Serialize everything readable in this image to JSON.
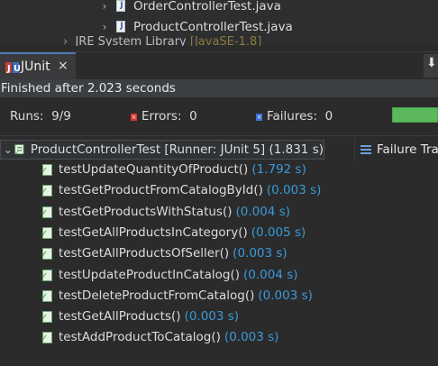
{
  "explorer": {
    "files": [
      {
        "label": "OrderControllerTest.java"
      },
      {
        "label": "ProductControllerTest.java"
      }
    ],
    "cut_row_label": "JRE System Library",
    "cut_row_suffix": "[JavaSE-1.8]"
  },
  "tab": {
    "label": "JUnit",
    "close": "×"
  },
  "status": "Finished after 2.023 seconds",
  "counters": {
    "runs_label": "Runs:",
    "runs_value": "9/9",
    "errors_label": "Errors:",
    "errors_value": "0",
    "failures_label": "Failures:",
    "failures_value": "0",
    "progress_fraction": 1.0,
    "progress_color": "#5cb85c"
  },
  "suite": {
    "label": "ProductControllerTest [Runner: JUnit 5] (1.831 s)"
  },
  "tests": [
    {
      "name": "testUpdateQuantityOfProduct()",
      "time": "(1.792 s)"
    },
    {
      "name": "testGetProductFromCatalogById()",
      "time": "(0.003 s)"
    },
    {
      "name": "testGetProductsWithStatus()",
      "time": "(0.004 s)"
    },
    {
      "name": "testGetAllProductsInCategory()",
      "time": "(0.005 s)"
    },
    {
      "name": "testGetAllProductsOfSeller()",
      "time": "(0.003 s)"
    },
    {
      "name": "testUpdateProductInCatalog()",
      "time": "(0.004 s)"
    },
    {
      "name": "testDeleteProductFromCatalog()",
      "time": "(0.003 s)"
    },
    {
      "name": "testGetAllProducts()",
      "time": "(0.003 s)"
    },
    {
      "name": "testAddProductToCatalog()",
      "time": "(0.003 s)"
    }
  ],
  "failure_trace": {
    "label": "Failure Trace"
  },
  "colors": {
    "time_text": "#3a9ad9",
    "pass_green": "#3aa83a"
  }
}
